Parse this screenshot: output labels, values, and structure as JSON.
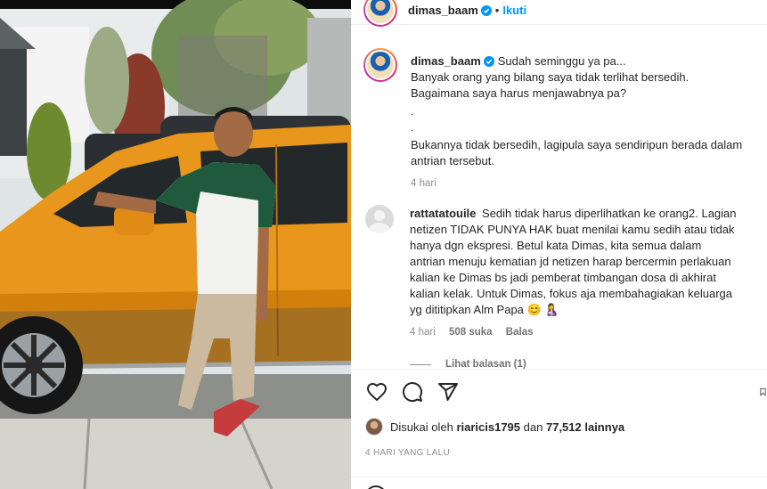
{
  "header": {
    "username": "dimas_baam",
    "dot": "•",
    "follow_label": "Ikuti"
  },
  "caption": {
    "username": "dimas_baam",
    "lines": [
      "Sudah seminggu ya pa...",
      "Banyak orang yang bilang saya tidak terlihat bersedih.",
      "Bagaimana saya harus menjawabnya pa?",
      ".",
      ".",
      "Bukannya tidak bersedih, lagipula saya sendiripun berada dalam",
      "antrian tersebut."
    ],
    "time": "4 hari"
  },
  "comment": {
    "username": "rattatatouile",
    "lines": [
      "Sedih tidak harus diperlihatkan ke orang2. Lagian",
      "netizen TIDAK PUNYA HAK buat menilai kamu sedih atau tidak",
      "hanya dgn ekspresi. Betul kata Dimas, kita semua dalam",
      "antrian menuju kematian jd netizen harap bercermin perlakuan",
      "kalian ke Dimas bs jadi pemberat timbangan dosa di akhirat",
      "kalian kelak. Untuk Dimas, fokus aja membahagiakan keluarga",
      "yg dititipkan Alm Papa 😊 🤱"
    ],
    "time": "4 hari",
    "likes": "508 suka",
    "reply": "Balas",
    "view_replies": "Lihat balasan (1)"
  },
  "likes": {
    "prefix": "Disukai oleh",
    "liker": "riaricis1795",
    "conj": "dan",
    "count": "77,512 lainnya"
  },
  "post_date": "4 HARI YANG LALU",
  "icons": {
    "like": "heart-icon",
    "comment": "comment-bubble-icon",
    "share": "paper-plane-icon",
    "save": "bookmark-icon",
    "verified": "verified-badge-icon"
  },
  "colors": {
    "follow": "#0095f6",
    "verified": "#0095f6",
    "car": "#e8961c"
  }
}
